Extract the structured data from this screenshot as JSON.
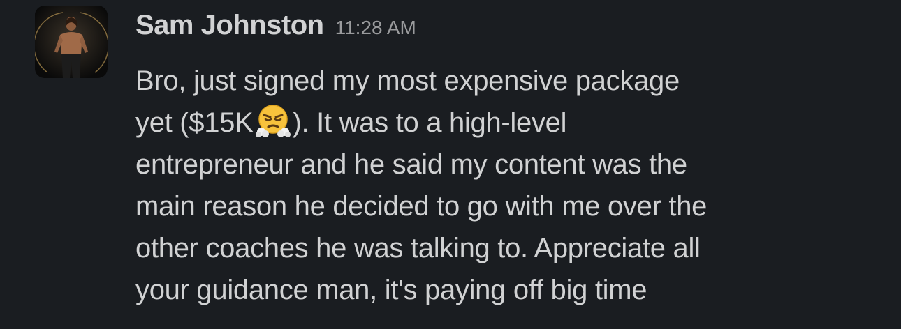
{
  "message": {
    "sender": "Sam Johnston",
    "timestamp": "11:28 AM",
    "avatar_icon": "user-photo-avatar",
    "emoji_icon": "face-with-steam-from-nose-emoji",
    "lines": [
      "Bro, just signed my most expensive package",
      "yet ($15K",
      "). It was to a high-level",
      "entrepreneur and he said my content was the",
      "main reason he decided to go with me over the",
      "other coaches he was talking to. Appreciate all",
      "your guidance man, it's paying off big time"
    ]
  },
  "colors": {
    "background": "#1a1d21",
    "text": "#d1d2d3",
    "timestamp": "#9a9b9d"
  }
}
